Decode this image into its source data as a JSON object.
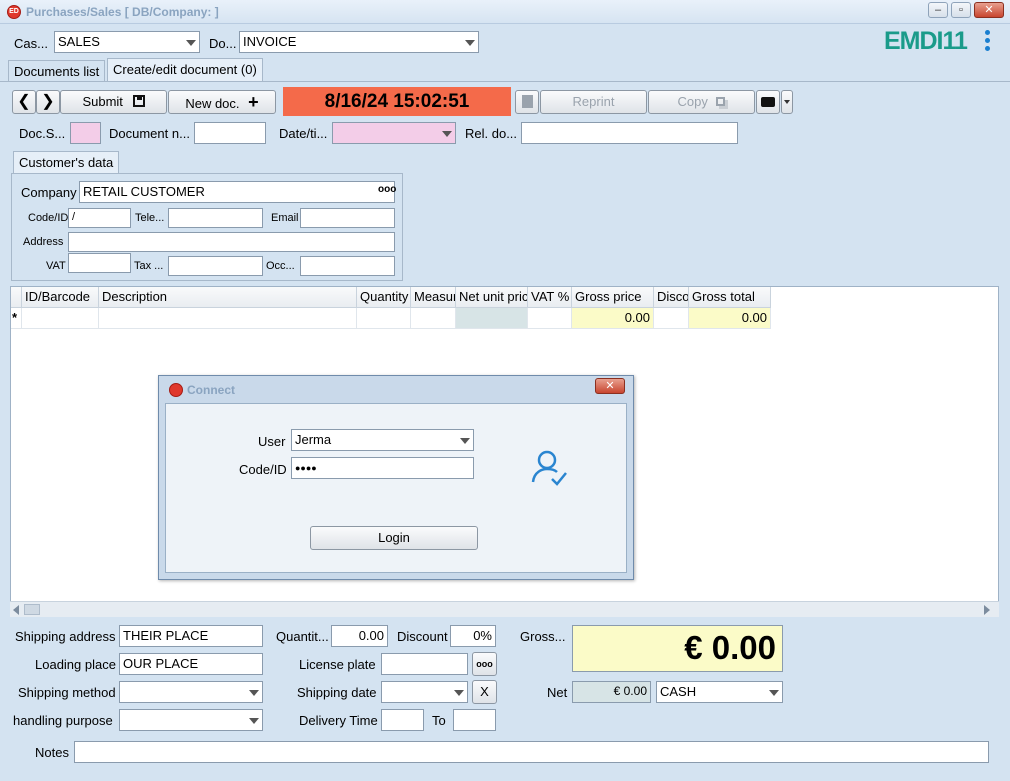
{
  "window": {
    "title": "Purchases/Sales   [ DB/Company:  ]",
    "icon_text": "ED",
    "buttons": [
      "–",
      "▫",
      "✕"
    ]
  },
  "top": {
    "cash_label": "Cas...",
    "cash_value": "SALES",
    "doc_label": "Do...",
    "doc_value": "INVOICE",
    "brand": "EMDI11",
    "brand_color": "#1a9b8a"
  },
  "tabs": [
    {
      "label": "Documents list"
    },
    {
      "label": "Create/edit document (0)"
    }
  ],
  "toolbar": {
    "submit": "Submit",
    "new_doc": "New doc.",
    "datetime": "8/16/24 15:02:51",
    "reprint": "Reprint",
    "copy": "Copy",
    "datetime_bg": "#f46a4a"
  },
  "docrow": {
    "doc_s": "Doc.S...",
    "doc_n": "Document n...",
    "date_ti": "Date/ti...",
    "rel_do": "Rel. do..."
  },
  "customer": {
    "tab": "Customer's data",
    "company_label": "Company",
    "company_value": "RETAIL CUSTOMER",
    "more": "ooo",
    "code_label": "Code/ID",
    "code_value": "/",
    "tele_label": "Tele...",
    "email_label": "Email",
    "address_label": "Address",
    "vat_label": "VAT",
    "tax_label": "Tax ...",
    "occ_label": "Occ..."
  },
  "grid": {
    "columns": [
      "ID/Barcode",
      "Description",
      "Quantity",
      "Measur",
      "Net unit pric",
      "VAT %",
      "Gross price",
      "Disco",
      "Gross total"
    ],
    "new_row_marker": "*",
    "gross_price": "0.00",
    "gross_total": "0.00"
  },
  "dialog": {
    "title": "Connect",
    "user_label": "User",
    "user_value": "Jerma",
    "code_label": "Code/ID",
    "code_value": "●●●●",
    "login": "Login"
  },
  "footer": {
    "shipping_address_label": "Shipping address",
    "shipping_address_value": "THEIR PLACE",
    "loading_place_label": "Loading place",
    "loading_place_value": "OUR PLACE",
    "shipping_method_label": "Shipping method",
    "handling_label": "handling purpose",
    "quantity_label": "Quantit...",
    "quantity_value": "0.00",
    "discount_label": "Discount",
    "discount_value": "0%",
    "license_label": "License plate",
    "more": "ooo",
    "shipping_date_label": "Shipping date",
    "clear": "X",
    "delivery_label": "Delivery Time",
    "to_label": "To",
    "gross_label": "Gross...",
    "gross_value": "€ 0.00",
    "net_label": "Net",
    "net_value": "€ 0.00",
    "payment": "CASH",
    "notes_label": "Notes"
  }
}
